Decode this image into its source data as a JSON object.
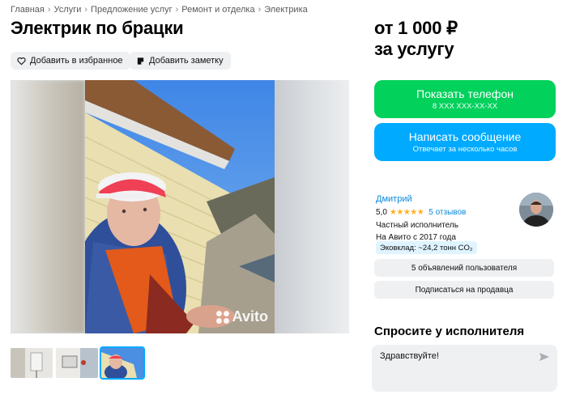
{
  "breadcrumb": [
    "Главная",
    "Услуги",
    "Предложение услуг",
    "Ремонт и отделка",
    "Электрика"
  ],
  "title": "Электрик по брацки",
  "actions": {
    "favorite": "Добавить в избранное",
    "note": "Добавить заметку"
  },
  "price": {
    "line1": "от 1 000 ₽",
    "line2": "за услугу"
  },
  "phone_button": {
    "label": "Показать телефон",
    "sub": "8 XXX XXX-XX-XX"
  },
  "message_button": {
    "label": "Написать сообщение",
    "sub": "Отвечает за несколько часов"
  },
  "seller": {
    "name": "Дмитрий",
    "rating": "5,0",
    "stars": "★★★★★",
    "reviews": "5 отзывов",
    "type": "Частный исполнитель",
    "since": "На Авито с 2017 года",
    "eco": "Эковклад: ~24,2 тонн CO₂"
  },
  "seller_buttons": {
    "ads": "5 объявлений пользователя",
    "subscribe": "Подписаться на продавца"
  },
  "ask": {
    "title": "Спросите у исполнителя",
    "message": "Здравствуйте!"
  },
  "gallery": {
    "watermark": "Avito",
    "thumb_count": 3,
    "active_thumb": 3
  },
  "colors": {
    "green": "#02d15c",
    "blue": "#00aaff",
    "link": "#0a88d8",
    "gray": "#eff0f2"
  },
  "icons": [
    "heart-icon",
    "note-icon",
    "send-icon",
    "star-icon",
    "avito-logo-icon"
  ]
}
